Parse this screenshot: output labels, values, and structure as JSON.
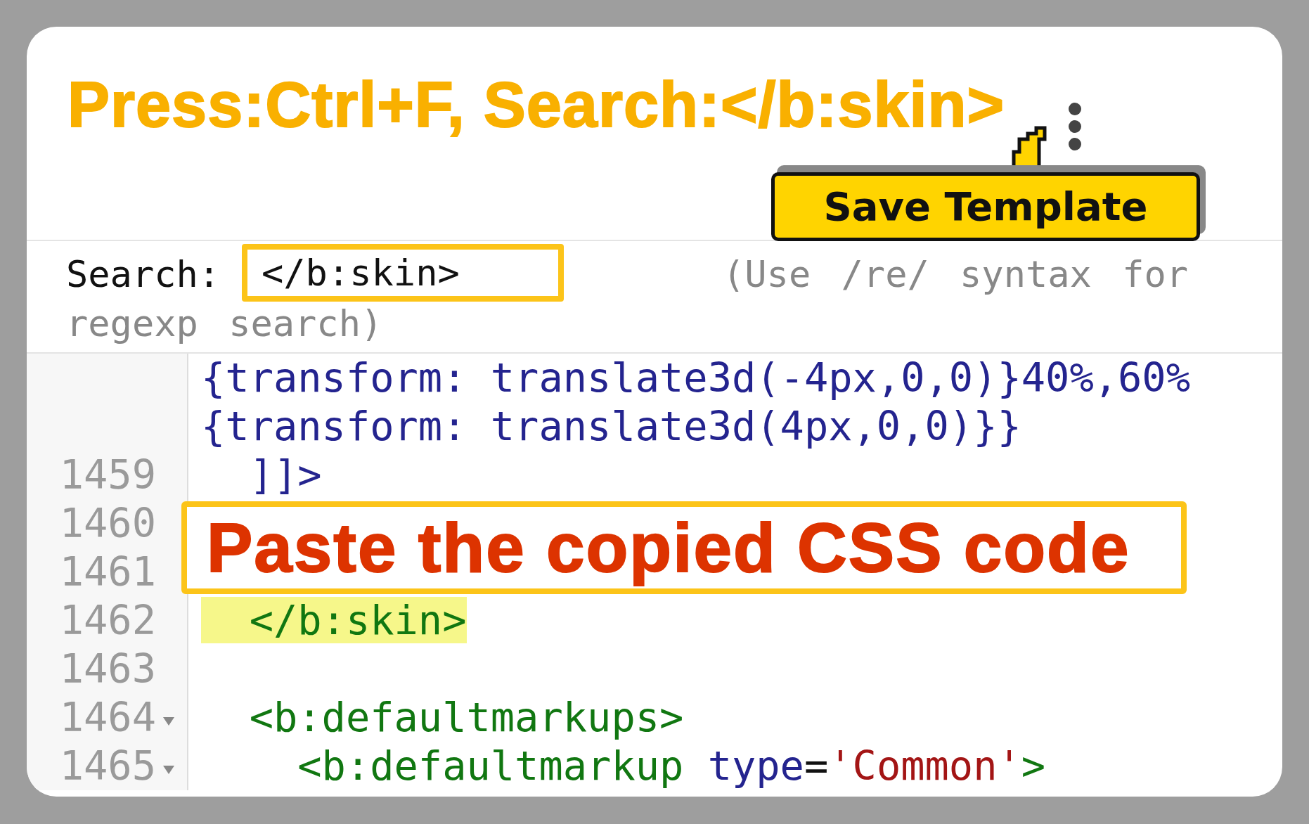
{
  "annotation_title": "Press:Ctrl+F, Search:</b:skin>",
  "save_button": {
    "label": "Save Template"
  },
  "search": {
    "label": "Search:",
    "value": "</b:skin>",
    "hint_lines": [
      "(Use /re/ syntax for",
      "regexp search)"
    ]
  },
  "code_lines": [
    {
      "foldable": false,
      "highlighted": false,
      "tokens": [
        {
          "kind": "value",
          "text": "{transform: translate3d(-4px,0,0)}40%,60%"
        }
      ]
    },
    {
      "foldable": false,
      "highlighted": false,
      "tokens": [
        {
          "kind": "value",
          "text": "{transform: translate3d(4px,0,0)}}"
        }
      ]
    },
    {
      "number": "1459",
      "foldable": false,
      "highlighted": false,
      "tokens": [
        {
          "kind": "value",
          "text": "  ]]>"
        }
      ]
    },
    {
      "number": "1460",
      "foldable": false,
      "highlighted": false
    },
    {
      "number": "1461",
      "foldable": false,
      "highlighted": false
    },
    {
      "number": "1462",
      "foldable": false,
      "highlighted": true,
      "tokens": [
        {
          "kind": "tag",
          "text": "  </b:skin>"
        }
      ]
    },
    {
      "number": "1463",
      "foldable": false,
      "highlighted": false
    },
    {
      "number": "1464",
      "foldable": true,
      "highlighted": false,
      "tokens": [
        {
          "kind": "tag",
          "text": "  <b:defaultmarkups>"
        }
      ]
    },
    {
      "number": "1465",
      "foldable": true,
      "highlighted": false,
      "tokens": [
        {
          "kind": "tag",
          "text": "    <b:defaultmarkup "
        },
        {
          "kind": "attr",
          "text": "type"
        },
        {
          "kind": "punct",
          "text": "="
        },
        {
          "kind": "string",
          "text": "'Common'"
        },
        {
          "kind": "tag",
          "text": ">"
        }
      ]
    }
  ],
  "callout": "Paste the copied CSS code"
}
